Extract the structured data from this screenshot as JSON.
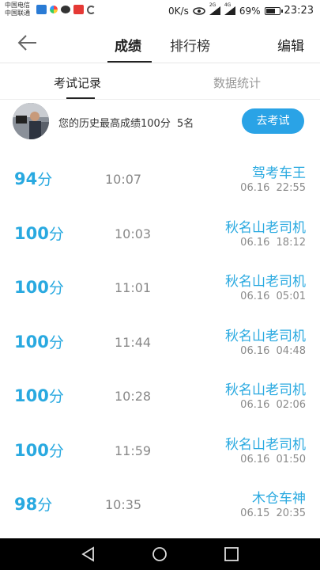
{
  "status_bar": {
    "carrier_1": "中国电信",
    "carrier_2": "中国联通",
    "speed": "0K/s",
    "signal_2g": "2G",
    "signal_4g": "4G",
    "battery_percent": "69%",
    "battery_level": 0.69,
    "time": "23:23"
  },
  "top_nav": {
    "tab_scores": "成绩",
    "tab_ranking": "排行榜",
    "edit": "编辑"
  },
  "sub_tabs": {
    "records": "考试记录",
    "stats": "数据统计"
  },
  "best": {
    "text": "您的历史最高成绩100分",
    "rank": "5名",
    "button": "去考试"
  },
  "records": [
    {
      "score": "94",
      "unit": "分",
      "duration": "10:07",
      "title": "驾考车王",
      "date": "06.16",
      "time": "22:55"
    },
    {
      "score": "100",
      "unit": "分",
      "duration": "10:03",
      "title": "秋名山老司机",
      "date": "06.16",
      "time": "18:12"
    },
    {
      "score": "100",
      "unit": "分",
      "duration": "11:01",
      "title": "秋名山老司机",
      "date": "06.16",
      "time": "05:01"
    },
    {
      "score": "100",
      "unit": "分",
      "duration": "11:44",
      "title": "秋名山老司机",
      "date": "06.16",
      "time": "04:48"
    },
    {
      "score": "100",
      "unit": "分",
      "duration": "10:28",
      "title": "秋名山老司机",
      "date": "06.16",
      "time": "02:06"
    },
    {
      "score": "100",
      "unit": "分",
      "duration": "11:59",
      "title": "秋名山老司机",
      "date": "06.16",
      "time": "01:50"
    },
    {
      "score": "98",
      "unit": "分",
      "duration": "10:35",
      "title": "木仓车神",
      "date": "06.15",
      "time": "20:35"
    }
  ],
  "colors": {
    "accent": "#29a9e0",
    "button": "#2aa3e6"
  }
}
